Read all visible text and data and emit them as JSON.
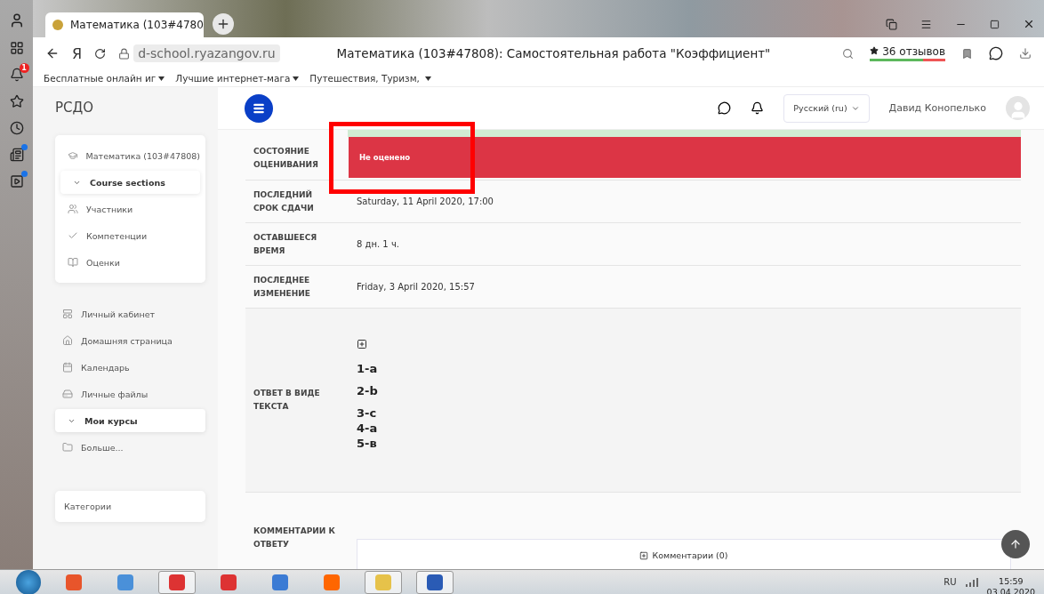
{
  "browser": {
    "logo": "Я",
    "tab_title": "Математика (103#4780",
    "url": "d-school.ryazangov.ru",
    "page_title": "Математика (103#47808): Самостоятельная работа \"Коэффициент\"",
    "reviews": "36 отзывов",
    "notification_count": "1",
    "bookmarks": [
      "Бесплатные онлайн иг",
      "Лучшие интернет-мага",
      "Путешествия, Туризм, "
    ]
  },
  "header": {
    "brand": "РСДО",
    "language": "Русский (ru)",
    "user_name": "Давид Конопелько"
  },
  "course_block": [
    {
      "kind": "course",
      "label": "Математика (103#47808)"
    },
    {
      "kind": "section",
      "label": "Course sections",
      "expanded": true
    },
    {
      "kind": "participants",
      "label": "Участники"
    },
    {
      "kind": "competencies",
      "label": "Компетенции"
    },
    {
      "kind": "grades",
      "label": "Оценки"
    }
  ],
  "nav": [
    {
      "kind": "dashboard",
      "label": "Личный кабинет"
    },
    {
      "kind": "home",
      "label": "Домашняя страница"
    },
    {
      "kind": "calendar",
      "label": "Календарь"
    },
    {
      "kind": "files",
      "label": "Личные файлы"
    },
    {
      "kind": "section",
      "label": "Мои курсы",
      "expanded": true
    },
    {
      "kind": "folder",
      "label": "Больше..."
    }
  ],
  "categories": "Категории",
  "submission": [
    {
      "kind": "status",
      "label": "СОСТОЯНИЕ ОЦЕНИВАНИЯ",
      "value": "Не оценено"
    },
    {
      "kind": "text",
      "label": "ПОСЛЕДНИЙ СРОК СДАЧИ",
      "value": "Saturday, 11 April 2020, 17:00"
    },
    {
      "kind": "text",
      "label": "ОСТАВШЕЕСЯ ВРЕМЯ",
      "value": "8 дн. 1 ч."
    },
    {
      "kind": "text",
      "label": "ПОСЛЕДНЕЕ ИЗМЕНЕНИЕ",
      "value": "Friday, 3 April 2020, 15:57"
    },
    {
      "kind": "answer",
      "label": "ОТВЕТ В ВИДЕ ТЕКСТА",
      "lines": [
        "1-a",
        "2-b",
        "3-c",
        "4-a",
        "5-в"
      ]
    },
    {
      "kind": "comments",
      "label": "КОММЕНТАРИИ К ОТВЕТУ",
      "value": "Комментарии (0)"
    }
  ],
  "taskbar": {
    "language": "RU",
    "time": "15:59",
    "date": "03.04.2020"
  }
}
